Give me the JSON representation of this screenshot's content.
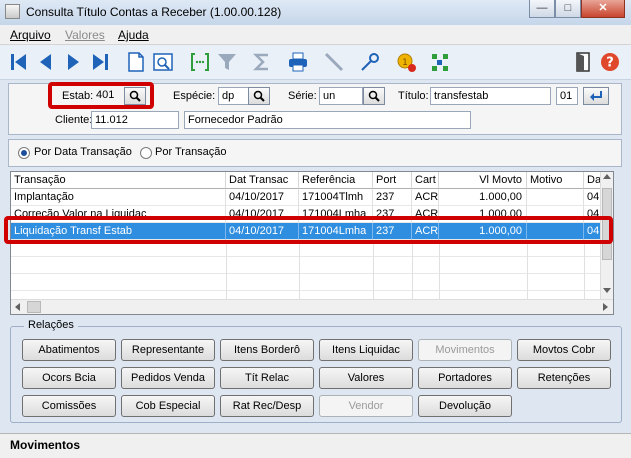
{
  "window": {
    "title": "Consulta Título Contas a Receber (1.00.00.128)",
    "minimize": "—",
    "maximize": "□",
    "close": "✕"
  },
  "menu": [
    {
      "label": "Arquivo"
    },
    {
      "label": "Valores"
    },
    {
      "label": "Ajuda"
    }
  ],
  "toolbar": {
    "icons": [
      "first-icon",
      "previous-icon",
      "next-icon",
      "last-icon",
      "new-document-icon",
      "zoom-window-icon",
      "goto-icon",
      "filter-icon",
      "sum-icon",
      "print-icon",
      "pen-icon",
      "key-icon",
      "coin-icon",
      "tree-icon",
      "exit-icon",
      "help-icon"
    ]
  },
  "header": {
    "estab_label": "Estab:",
    "estab_value": "401",
    "especie_label": "Espécie:",
    "especie_value": "dp",
    "serie_label": "Série:",
    "serie_value": "un",
    "titulo_label": "Título:",
    "titulo_value": "transfestab",
    "parcela_value": "01",
    "cliente_label": "Cliente:",
    "cliente_code": "11.012",
    "cliente_name": "Fornecedor Padrão"
  },
  "sort": {
    "option1": "Por Data Transação",
    "option2": "Por Transação",
    "selected": 1
  },
  "grid": {
    "columns": [
      "Transação",
      "Dat Transac",
      "Referência",
      "Port",
      "Cart",
      "Vl Movto",
      "Motivo",
      "Da"
    ],
    "rows": [
      {
        "transacao": "Implantação",
        "data": "04/10/2017",
        "ref": "171004Tlmh",
        "port": "237",
        "cart": "ACR",
        "valor": "1.000,00",
        "motivo": "",
        "da": "04"
      },
      {
        "transacao": "Correção Valor na Liquidac",
        "data": "04/10/2017",
        "ref": "171004Lmha",
        "port": "237",
        "cart": "ACR",
        "valor": "1.000,00",
        "motivo": "",
        "da": "04"
      },
      {
        "transacao": "Liquidação Transf Estab",
        "data": "04/10/2017",
        "ref": "171004Lmha",
        "port": "237",
        "cart": "ACR",
        "valor": "1.000,00",
        "motivo": "",
        "da": "04"
      }
    ],
    "selected_row": 2
  },
  "relations": {
    "title": "Relações",
    "buttons": [
      [
        "Abatimentos",
        "Representante",
        "Itens Borderô",
        "Itens Liquidac",
        "Movimentos",
        "Movtos Cobr"
      ],
      [
        "Ocors Bcia",
        "Pedidos Venda",
        "Tít Relac",
        "Valores",
        "Portadores",
        "Retenções"
      ],
      [
        "Comissões",
        "Cob Especial",
        "Rat Rec/Desp",
        "Vendor",
        "Devolução"
      ]
    ]
  },
  "status": {
    "text": "Movimentos"
  },
  "colors": {
    "highlight": "#d00000",
    "selection": "#2f8ee0",
    "background": "#dde6f1"
  }
}
